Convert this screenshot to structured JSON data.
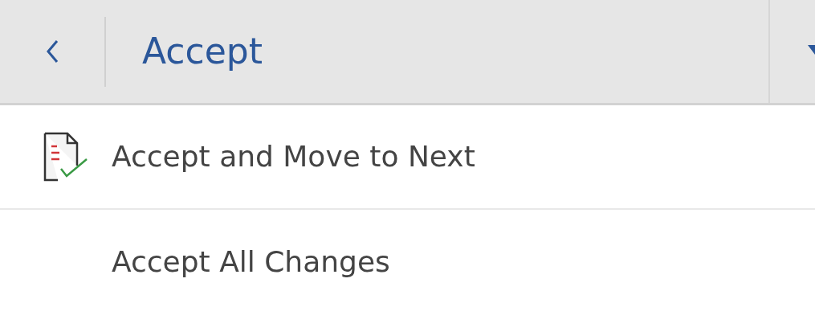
{
  "header": {
    "title": "Accept"
  },
  "items": [
    {
      "label": "Accept and Move to Next",
      "icon": true
    },
    {
      "label": "Accept All Changes",
      "icon": false
    }
  ]
}
